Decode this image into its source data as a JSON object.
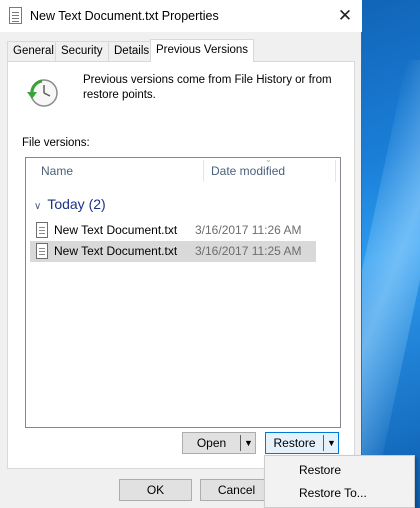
{
  "window": {
    "title": "New Text Document.txt Properties",
    "close_glyph": "✕"
  },
  "tabs": [
    {
      "label": "General"
    },
    {
      "label": "Security"
    },
    {
      "label": "Details"
    },
    {
      "label": "Previous Versions",
      "active": true
    }
  ],
  "panel": {
    "info_text": "Previous versions come from File History or from restore points.",
    "versions_label": "File versions:",
    "columns": {
      "name": "Name",
      "date": "Date modified"
    },
    "group": {
      "label": "Today (2)",
      "chevron": "∨"
    },
    "rows": [
      {
        "name": "New Text Document.txt",
        "date": "3/16/2017 11:26 AM",
        "selected": false
      },
      {
        "name": "New Text Document.txt",
        "date": "3/16/2017 11:25 AM",
        "selected": true
      }
    ]
  },
  "buttons": {
    "open": "Open",
    "restore": "Restore",
    "ok": "OK",
    "cancel": "Cancel",
    "dropdown_glyph": "▼"
  },
  "restore_menu": {
    "items": [
      "Restore",
      "Restore To..."
    ]
  },
  "colors": {
    "group_header": "#1e3287",
    "focus_border": "#0078d7",
    "desktop": "#0b4f9c"
  },
  "icons": {
    "title": "text-document-icon",
    "history": "file-history-clock-icon",
    "file": "text-document-icon"
  }
}
